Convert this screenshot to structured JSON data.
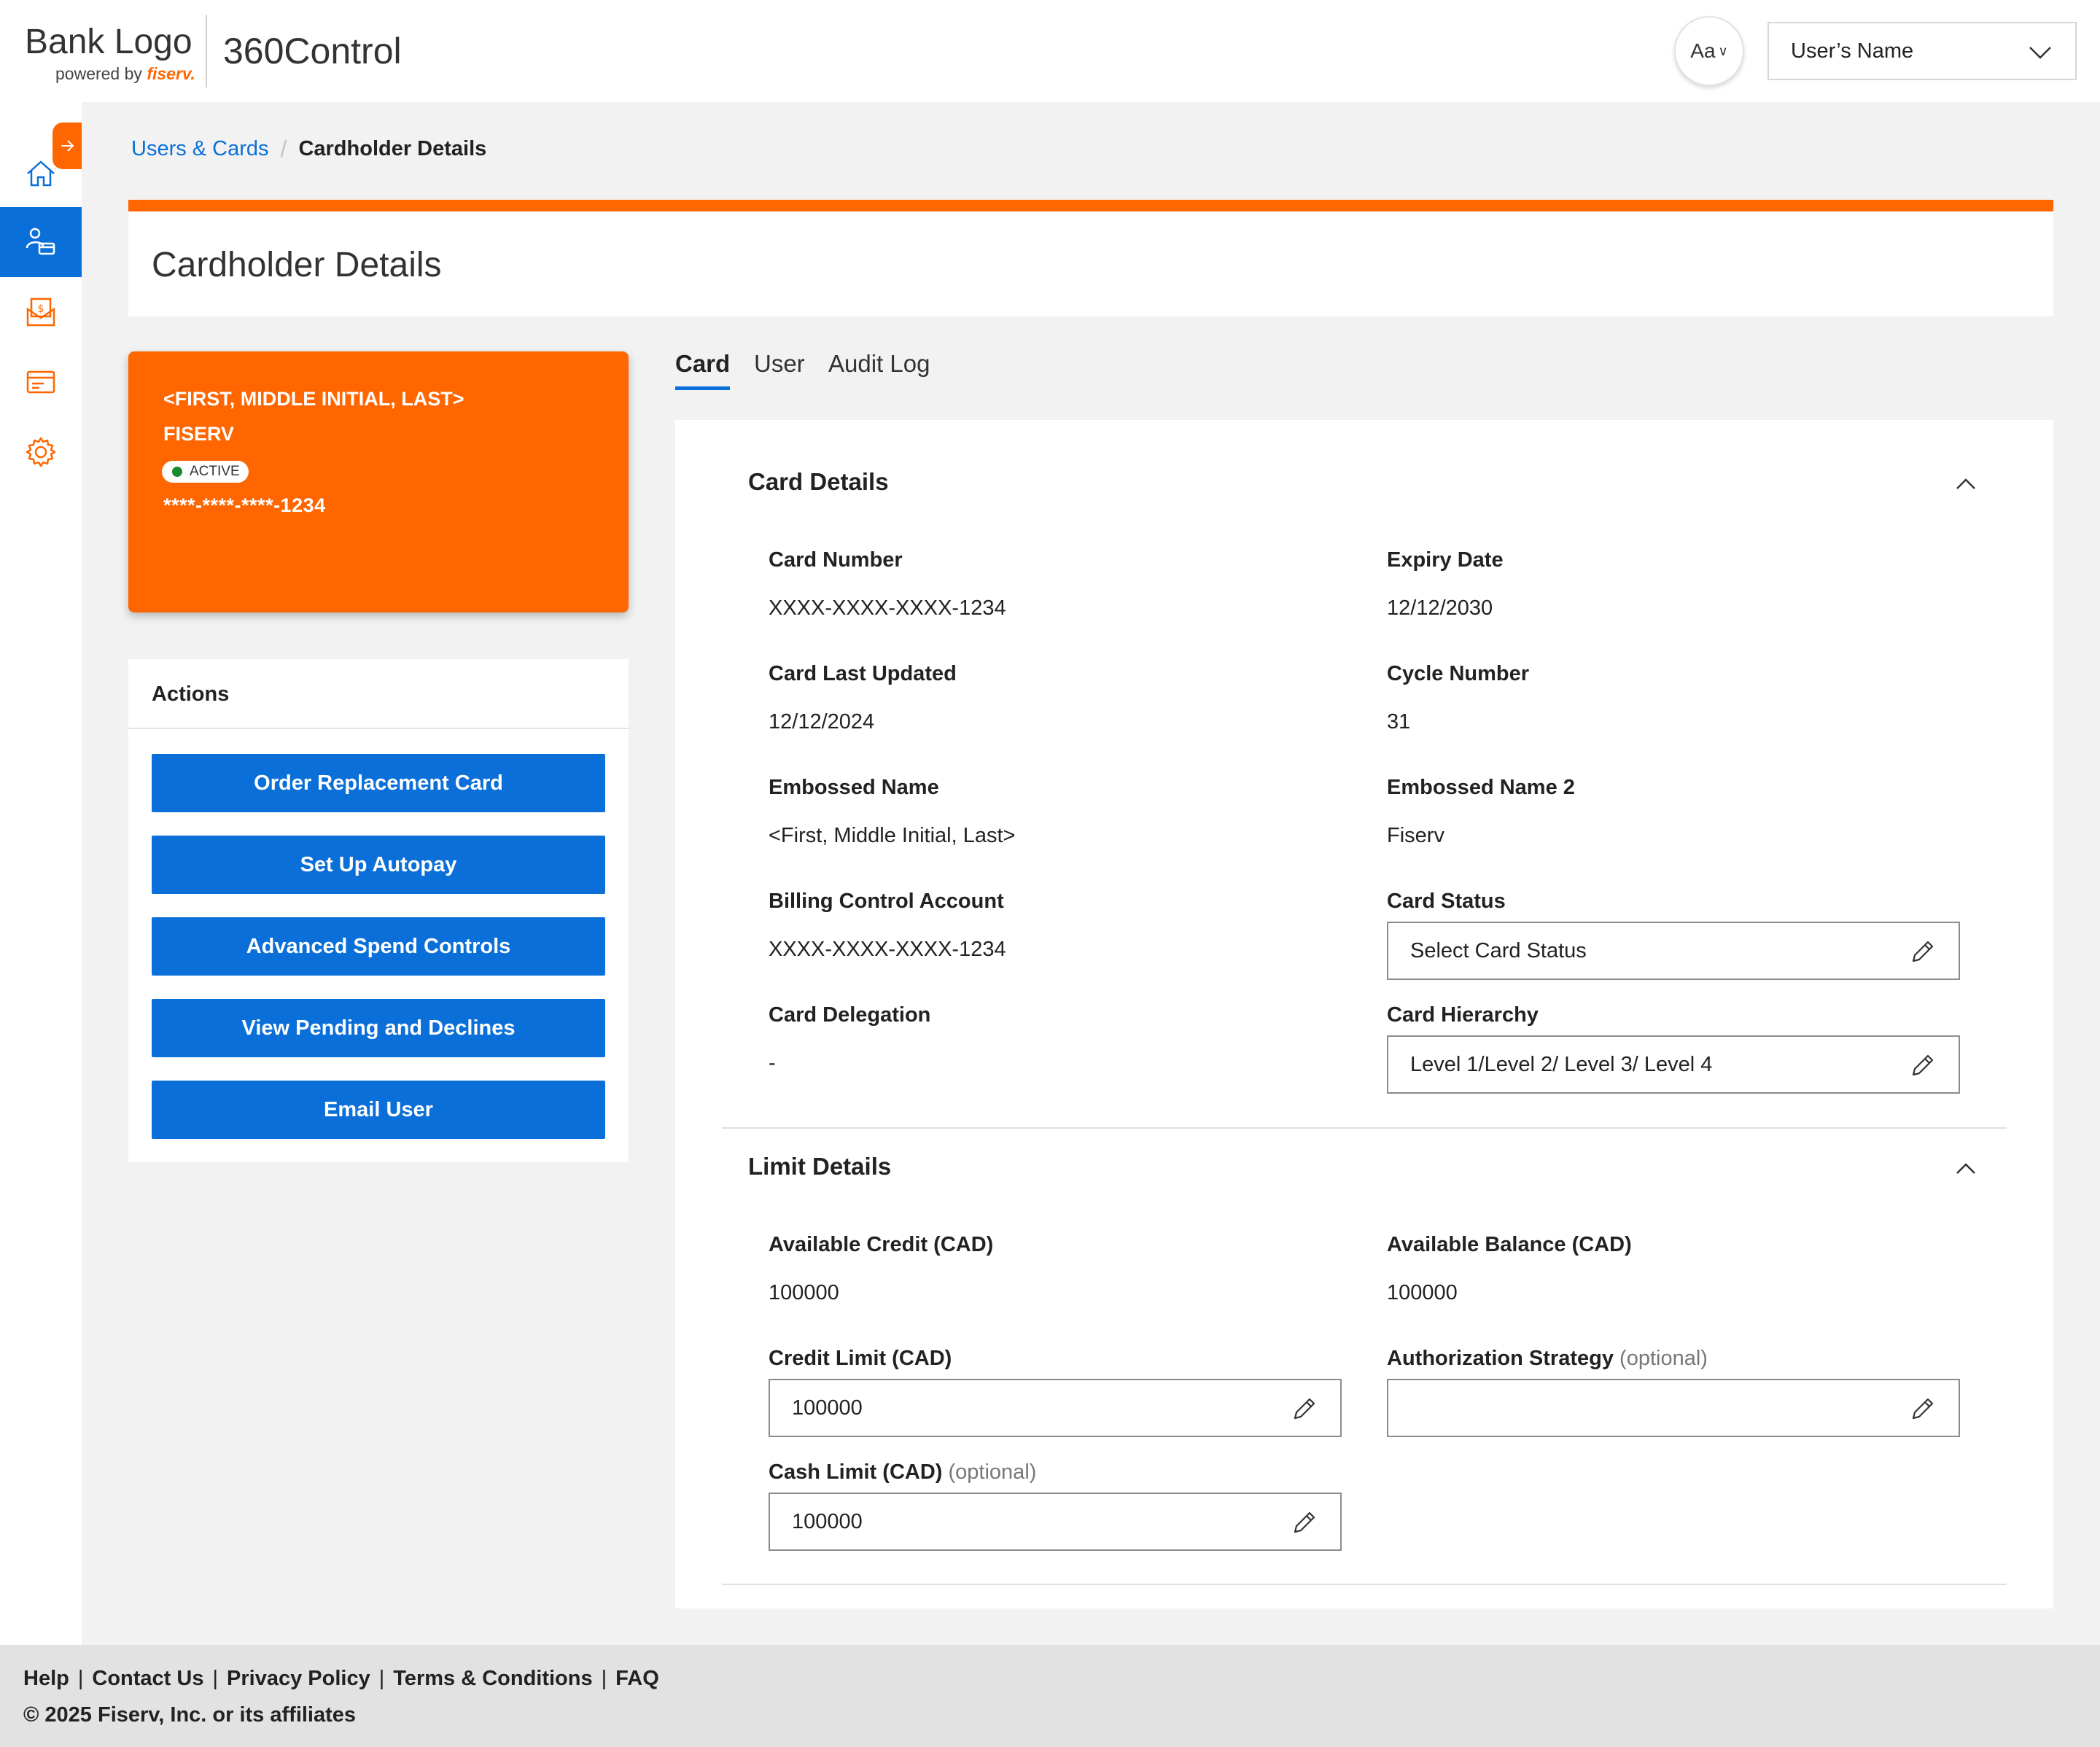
{
  "header": {
    "bank_logo": "Bank Logo",
    "powered_by": "powered by",
    "fiserv_mark": "fiserv.",
    "app_name": "360Control",
    "font_toggle_label": "Aa",
    "user_name": "User’s Name"
  },
  "sidenav": {
    "items": [
      {
        "icon": "home-icon"
      },
      {
        "icon": "users-cards-icon",
        "active": true
      },
      {
        "icon": "statement-icon"
      },
      {
        "icon": "card-icon"
      },
      {
        "icon": "gear-icon"
      }
    ]
  },
  "breadcrumb": {
    "parent": "Users & Cards",
    "separator": "/",
    "current": "Cardholder Details"
  },
  "page_title": "Cardholder Details",
  "card_visual": {
    "name": "<FIRST, MIDDLE INITIAL, LAST>",
    "org": "FISERV",
    "status": "ACTIVE",
    "number": "****-****-****-1234"
  },
  "actions": {
    "title": "Actions",
    "buttons": [
      "Order Replacement Card",
      "Set Up Autopay",
      "Advanced Spend Controls",
      "View Pending and Declines",
      "Email User"
    ]
  },
  "tabs": [
    "Card",
    "User",
    "Audit Log"
  ],
  "card_details": {
    "title": "Card Details",
    "card_number_label": "Card Number",
    "card_number": "XXXX-XXXX-XXXX-1234",
    "expiry_label": "Expiry Date",
    "expiry": "12/12/2030",
    "last_updated_label": "Card Last Updated",
    "last_updated": "12/12/2024",
    "cycle_label": "Cycle Number",
    "cycle": "31",
    "embossed_label": "Embossed Name",
    "embossed": "<First, Middle Initial, Last>",
    "embossed2_label": "Embossed Name 2",
    "embossed2": "Fiserv",
    "billing_label": "Billing Control Account",
    "billing": "XXXX-XXXX-XXXX-1234",
    "status_label": "Card Status",
    "status_value": "Select Card Status",
    "delegation_label": "Card Delegation",
    "delegation": "-",
    "hierarchy_label": "Card Hierarchy",
    "hierarchy_value": "Level 1/Level 2/ Level 3/ Level 4"
  },
  "limit_details": {
    "title": "Limit Details",
    "avail_credit_label": "Available Credit (CAD)",
    "avail_credit": "100000",
    "avail_balance_label": "Available Balance (CAD)",
    "avail_balance": "100000",
    "credit_limit_label": "Credit Limit (CAD)",
    "credit_limit": "100000",
    "auth_strategy_label": "Authorization Strategy",
    "auth_strategy_optional": "(optional)",
    "auth_strategy": "",
    "cash_limit_label": "Cash Limit (CAD)",
    "cash_limit_optional": "(optional)",
    "cash_limit": "100000"
  },
  "footer": {
    "links": [
      "Help",
      "Contact Us",
      "Privacy Policy",
      "Terms & Conditions",
      "FAQ"
    ],
    "separator": "|",
    "copyright": "© 2025 Fiserv, Inc. or its affiliates"
  },
  "colors": {
    "accent_orange": "#ff6600",
    "primary_blue": "#0a6fd8",
    "status_green": "#1a8a2e"
  }
}
